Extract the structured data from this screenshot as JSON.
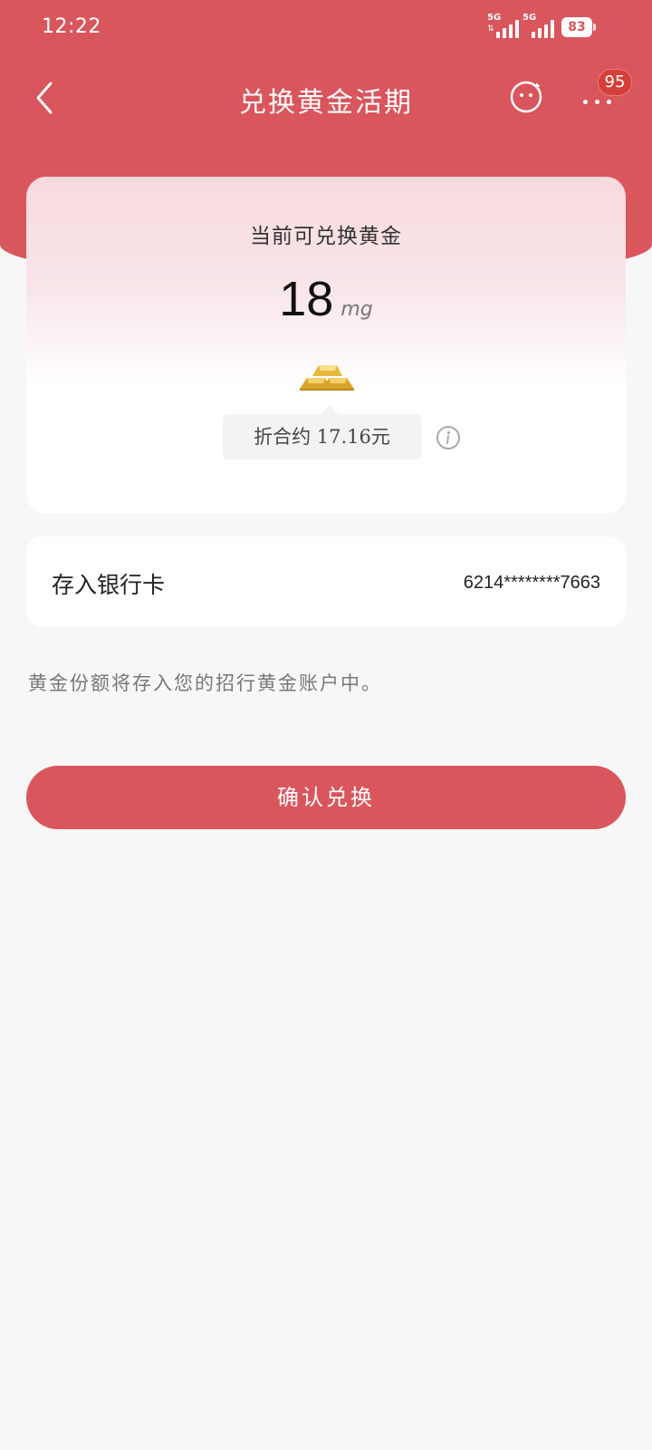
{
  "status_bar": {
    "time": "12:22",
    "network_1": "5G",
    "network_2": "5G",
    "battery": "83"
  },
  "header": {
    "title": "兑换黄金活期",
    "back_icon": "chevron-left-icon",
    "service_icon": "smiley-face-icon",
    "more_icon": "more-dots-icon",
    "more_badge": "95"
  },
  "gold_card": {
    "title": "当前可兑换黄金",
    "amount": "18",
    "unit": "mg",
    "approx_label": "折合约 17.16元",
    "gold_icon": "gold-bars-icon",
    "info_icon": "info-icon"
  },
  "bank_card": {
    "label": "存入银行卡",
    "number": "6214********7663"
  },
  "note": "黄金份额将存入您的招行黄金账户中。",
  "confirm_button": "确认兑换",
  "colors": {
    "primary_red": "#d9565c",
    "badge_red": "#d43f3a",
    "gold": "#e8b83a"
  }
}
